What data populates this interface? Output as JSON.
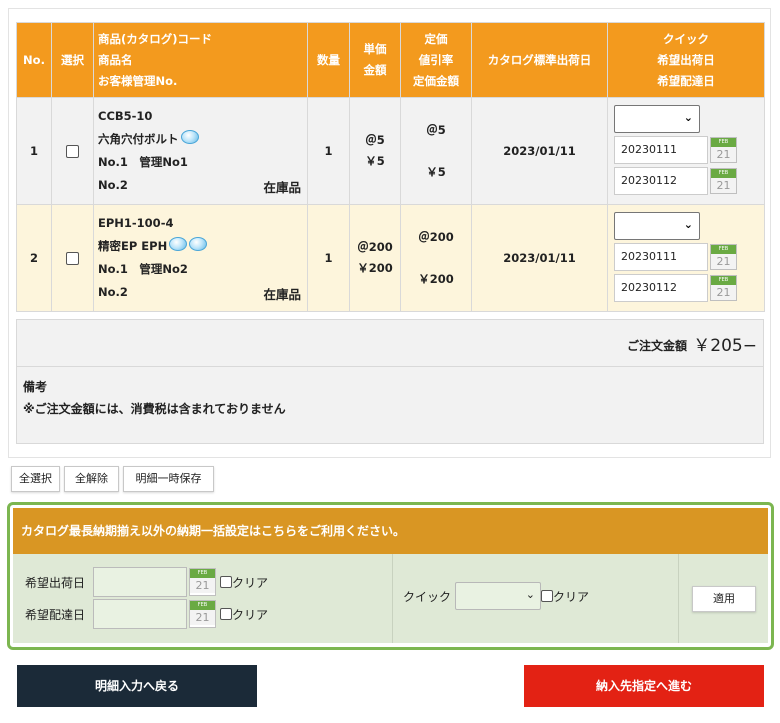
{
  "table": {
    "headers": {
      "no": "No.",
      "select": "選択",
      "product_line1": "商品(カタログ)コード",
      "product_line2": "商品名",
      "product_line3": "お客様管理No.",
      "qty": "数量",
      "unit_line1": "単価",
      "unit_line2": "金額",
      "list_line1": "定価",
      "list_line2": "値引率",
      "list_line3": "定価金額",
      "catalog_date": "カタログ標準出荷日",
      "quick_line1": "クイック",
      "quick_line2": "希望出荷日",
      "quick_line3": "希望配達日"
    },
    "rows": [
      {
        "no": "1",
        "code": "CCB5-10",
        "name": "六角穴付ボルト",
        "mgmt": "No.1　管理No1",
        "mgmt2": "No.2",
        "stock": "在庫品",
        "qty": "1",
        "unit": "＠5",
        "amount": "￥5",
        "list": "＠5",
        "list_amount": "￥5",
        "catalog_date": "2023/01/11",
        "ship_date": "20230111",
        "delivery_date": "20230112"
      },
      {
        "no": "2",
        "code": "EPH1-100-4",
        "name": "精密EP EPH",
        "mgmt": "No.1　管理No2",
        "mgmt2": "No.2",
        "stock": "在庫品",
        "qty": "1",
        "unit": "＠200",
        "amount": "￥200",
        "list": "＠200",
        "list_amount": "￥200",
        "catalog_date": "2023/01/11",
        "ship_date": "20230111",
        "delivery_date": "20230112"
      }
    ],
    "calendar": {
      "month": "FEB",
      "day": "21"
    }
  },
  "total": {
    "label": "ご注文金額",
    "value": "￥205−"
  },
  "notes": {
    "title": "備考",
    "text": "※ご注文金額には、消費税は含まれておりません"
  },
  "buttons": {
    "select_all": "全選択",
    "deselect_all": "全解除",
    "save_temp": "明細一時保存"
  },
  "bulk": {
    "header": "カタログ最長納期揃え以外の納期一括設定はこちらをご利用ください。",
    "ship_label": "希望出荷日",
    "delivery_label": "希望配達日",
    "clear_label": "クリア",
    "quick_label": "クイック",
    "apply_label": "適用"
  },
  "nav": {
    "back": "明細入力へ戻る",
    "next": "納入先指定へ進む"
  },
  "colors": {
    "header_orange": "#f39a1e",
    "bulk_header": "#d99623",
    "bulk_border": "#7cb650",
    "back_button": "#1b2a38",
    "next_button": "#e32214"
  }
}
